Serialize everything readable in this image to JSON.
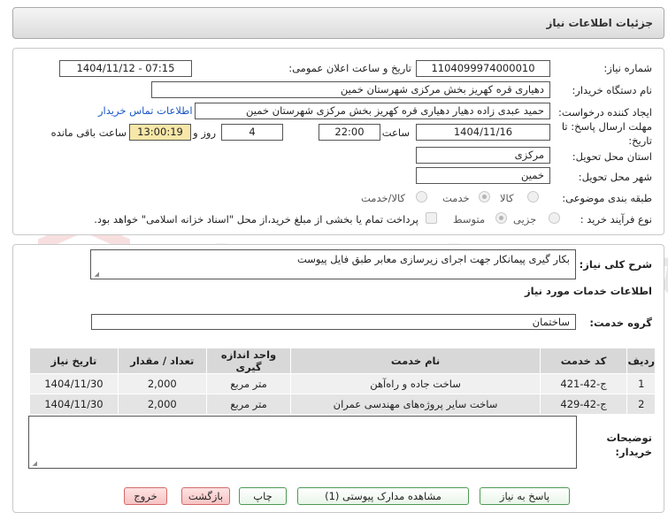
{
  "header": {
    "title": "جزئیات اطلاعات نیاز"
  },
  "fields": {
    "need_number_label": "شماره نیاز:",
    "need_number": "1104099974000010",
    "announce_label": "تاریخ و ساعت اعلان عمومی:",
    "announce_value": "1404/11/12 - 07:15",
    "buyer_org_label": "نام دستگاه خریدار:",
    "buyer_org": "دهیاری قره کهریز بخش مرکزی شهرستان خمین",
    "requester_label": "ایجاد کننده درخواست:",
    "requester": "حمید عبدی زاده دهیار دهیاری قره کهریز بخش مرکزی شهرستان خمین",
    "contact_link": "اطلاعات تماس خریدار",
    "deadline_label": "مهلت ارسال پاسخ: تا تاریخ:",
    "deadline_date": "1404/11/16",
    "time_label": "ساعت",
    "deadline_time": "22:00",
    "days_value": "4",
    "days_label": "روز و",
    "remaining_time": "13:00:19",
    "remaining_label": "ساعت باقی مانده",
    "province_label": "استان محل تحویل:",
    "province": "مرکزی",
    "city_label": "شهر محل تحویل:",
    "city": "خمین",
    "category_label": "طبقه بندی موضوعی:",
    "category_options": [
      "کالا",
      "خدمت",
      "کالا/خدمت"
    ],
    "process_label": "نوع فرآیند خرید :",
    "process_options": [
      "جزیی",
      "متوسط"
    ],
    "payment_note": "پرداخت تمام یا بخشی از مبلغ خرید،از محل \"اسناد خزانه اسلامی\" خواهد بود."
  },
  "description": {
    "label": "شرح کلی نیاز:",
    "text": "بکار گیری پیمانکار جهت اجرای زیرسازی معابر طبق فایل پیوست"
  },
  "services": {
    "section_title": "اطلاعات خدمات مورد نیاز",
    "group_label": "گروه خدمت:",
    "group_value": "ساختمان",
    "columns": [
      "ردیف",
      "کد خدمت",
      "نام خدمت",
      "واحد اندازه گیری",
      "تعداد / مقدار",
      "تاریخ نیاز"
    ],
    "rows": [
      [
        "1",
        "ج-42-421",
        "ساخت جاده و راه‌آهن",
        "متر مربع",
        "2,000",
        "1404/11/30"
      ],
      [
        "2",
        "ج-42-429",
        "ساخت سایر پروژه‌های مهندسی عمران",
        "متر مربع",
        "2,000",
        "1404/11/30"
      ]
    ]
  },
  "buyer_notes": {
    "label": "توضیحات خریدار:",
    "text": ""
  },
  "buttons": {
    "reply": "پاسخ به نیاز",
    "view_docs": "مشاهده مدارک پیوستی (1)",
    "print": "چاپ",
    "back": "بازگشت",
    "exit": "خروج"
  },
  "watermark": "AriaTender.net"
}
